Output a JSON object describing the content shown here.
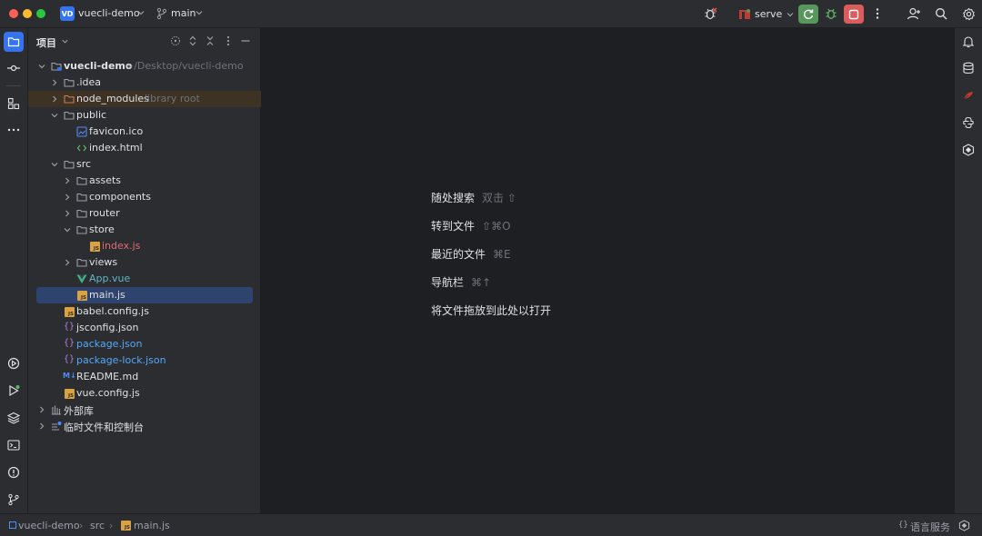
{
  "titlebar": {
    "project_badge": "VD",
    "project_name": "vuecli-demo",
    "branch": "main",
    "run_config": "serve",
    "colors": {
      "run_green": "#57965c",
      "stop_red": "#db5c5c",
      "accent": "#3574f0"
    }
  },
  "panel": {
    "title": "项目",
    "tree": [
      {
        "label": "vuecli-demo",
        "sub": "~/Desktop/vuecli-demo",
        "icon": "folder-module-icon",
        "state": "expanded"
      },
      {
        "label": ".idea",
        "icon": "folder-icon",
        "state": "collapsed"
      },
      {
        "label": "node_modules",
        "sub": "library root",
        "icon": "folder-orange-icon",
        "state": "collapsed"
      },
      {
        "label": "public",
        "icon": "folder-icon",
        "state": "expanded"
      },
      {
        "label": "favicon.ico",
        "icon": "image-file-icon"
      },
      {
        "label": "index.html",
        "icon": "html-file-icon"
      },
      {
        "label": "src",
        "icon": "folder-icon",
        "state": "expanded"
      },
      {
        "label": "assets",
        "icon": "folder-icon",
        "state": "collapsed"
      },
      {
        "label": "components",
        "icon": "folder-icon",
        "state": "collapsed"
      },
      {
        "label": "router",
        "icon": "folder-icon",
        "state": "collapsed"
      },
      {
        "label": "store",
        "icon": "folder-icon",
        "state": "expanded"
      },
      {
        "label": "index.js",
        "icon": "js-file-icon"
      },
      {
        "label": "views",
        "icon": "folder-icon",
        "state": "collapsed"
      },
      {
        "label": "App.vue",
        "icon": "vue-file-icon"
      },
      {
        "label": "main.js",
        "icon": "js-file-icon",
        "selected": true
      },
      {
        "label": "babel.config.js",
        "icon": "js-file-icon"
      },
      {
        "label": "jsconfig.json",
        "icon": "json-file-icon"
      },
      {
        "label": "package.json",
        "icon": "json-file-icon"
      },
      {
        "label": "package-lock.json",
        "icon": "json-file-icon"
      },
      {
        "label": "README.md",
        "icon": "markdown-file-icon"
      },
      {
        "label": "vue.config.js",
        "icon": "js-file-icon"
      },
      {
        "label": "外部库",
        "icon": "library-icon",
        "state": "collapsed"
      },
      {
        "label": "临时文件和控制台",
        "icon": "scratches-icon",
        "state": "collapsed"
      }
    ]
  },
  "editor": {
    "hints": [
      {
        "label": "随处搜索",
        "key": "双击 ⇧"
      },
      {
        "label": "转到文件",
        "key": "⇧⌘O"
      },
      {
        "label": "最近的文件",
        "key": "⌘E"
      },
      {
        "label": "导航栏",
        "key": "⌘↑"
      },
      {
        "label": "将文件拖放到此处以打开",
        "key": ""
      }
    ]
  },
  "statusbar": {
    "breadcrumb": [
      "vuecli-demo",
      "src",
      "main.js"
    ],
    "language_services": "语言服务"
  }
}
